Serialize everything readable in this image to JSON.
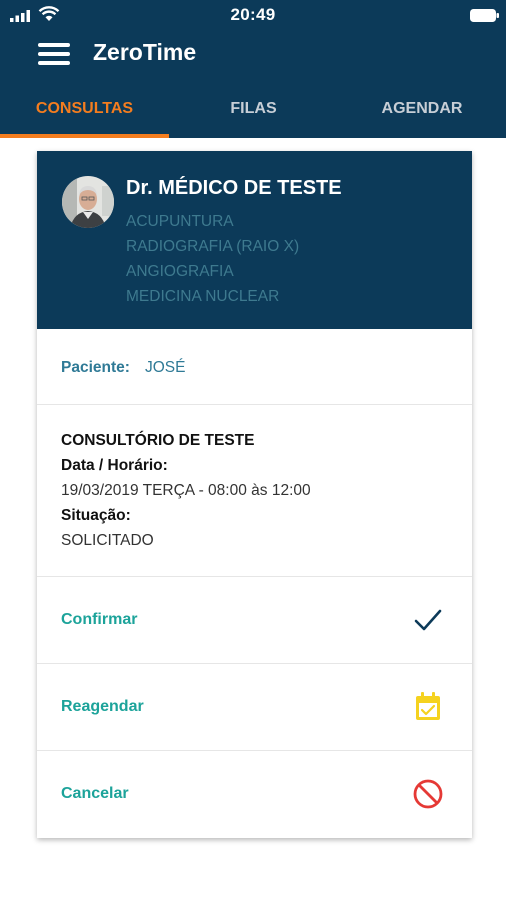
{
  "status_bar": {
    "time": "20:49",
    "icons": [
      "signal-icon",
      "wifi-icon",
      "battery-icon"
    ]
  },
  "app": {
    "title": "ZeroTime",
    "menu_icon": "hamburger-menu-icon"
  },
  "tabs": [
    {
      "label": "CONSULTAS",
      "active": true
    },
    {
      "label": "FILAS",
      "active": false
    },
    {
      "label": "AGENDAR",
      "active": false
    }
  ],
  "doctor": {
    "name": "Dr. MÉDICO DE TESTE",
    "specialties": [
      "ACUPUNTURA",
      "RADIOGRAFIA (RAIO X)",
      "ANGIOGRAFIA",
      "MEDICINA NUCLEAR"
    ]
  },
  "patient": {
    "label": "Paciente:",
    "name": "JOSÉ"
  },
  "appointment": {
    "office": "CONSULTÓRIO DE TESTE",
    "datetime_label": "Data / Horário:",
    "datetime_value": "19/03/2019 TERÇA - 08:00 às 12:00",
    "status_label": "Situação:",
    "status_value": "SOLICITADO"
  },
  "actions": [
    {
      "label": "Confirmar",
      "icon": "checkmark-icon"
    },
    {
      "label": "Reagendar",
      "icon": "calendar-check-icon"
    },
    {
      "label": "Cancelar",
      "icon": "prohibited-icon"
    }
  ],
  "colors": {
    "primary": "#0c3a59",
    "accent": "#f47d1f",
    "action_text": "#1ca39a",
    "specialty_text": "#3e7a8f",
    "calendar_icon": "#f5d21f",
    "cancel_icon": "#e53935"
  }
}
